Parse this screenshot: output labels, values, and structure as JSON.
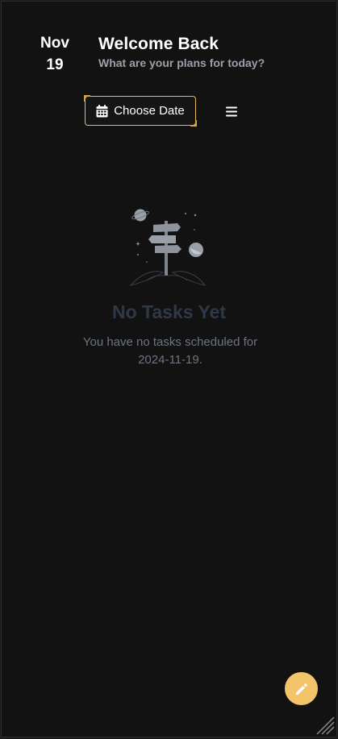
{
  "header": {
    "date_month": "Nov",
    "date_day": "19",
    "title": "Welcome Back",
    "subtitle": "What are your plans for today?"
  },
  "toolbar": {
    "choose_date_label": "Choose Date",
    "calendar_icon": "calendar-icon",
    "menu_icon": "hamburger-menu-icon"
  },
  "empty_state": {
    "illustration": "signpost-planets-illustration",
    "title": "No Tasks Yet",
    "message": "You have no tasks scheduled for 2024-11-19."
  },
  "fab": {
    "icon": "pencil-icon"
  },
  "colors": {
    "background": "#121212",
    "accent": "#f3c469",
    "button_border": "#e8b85a",
    "subtitle": "#9aa0aa",
    "empty_title": "#2f3848",
    "empty_text": "#6d7480"
  }
}
